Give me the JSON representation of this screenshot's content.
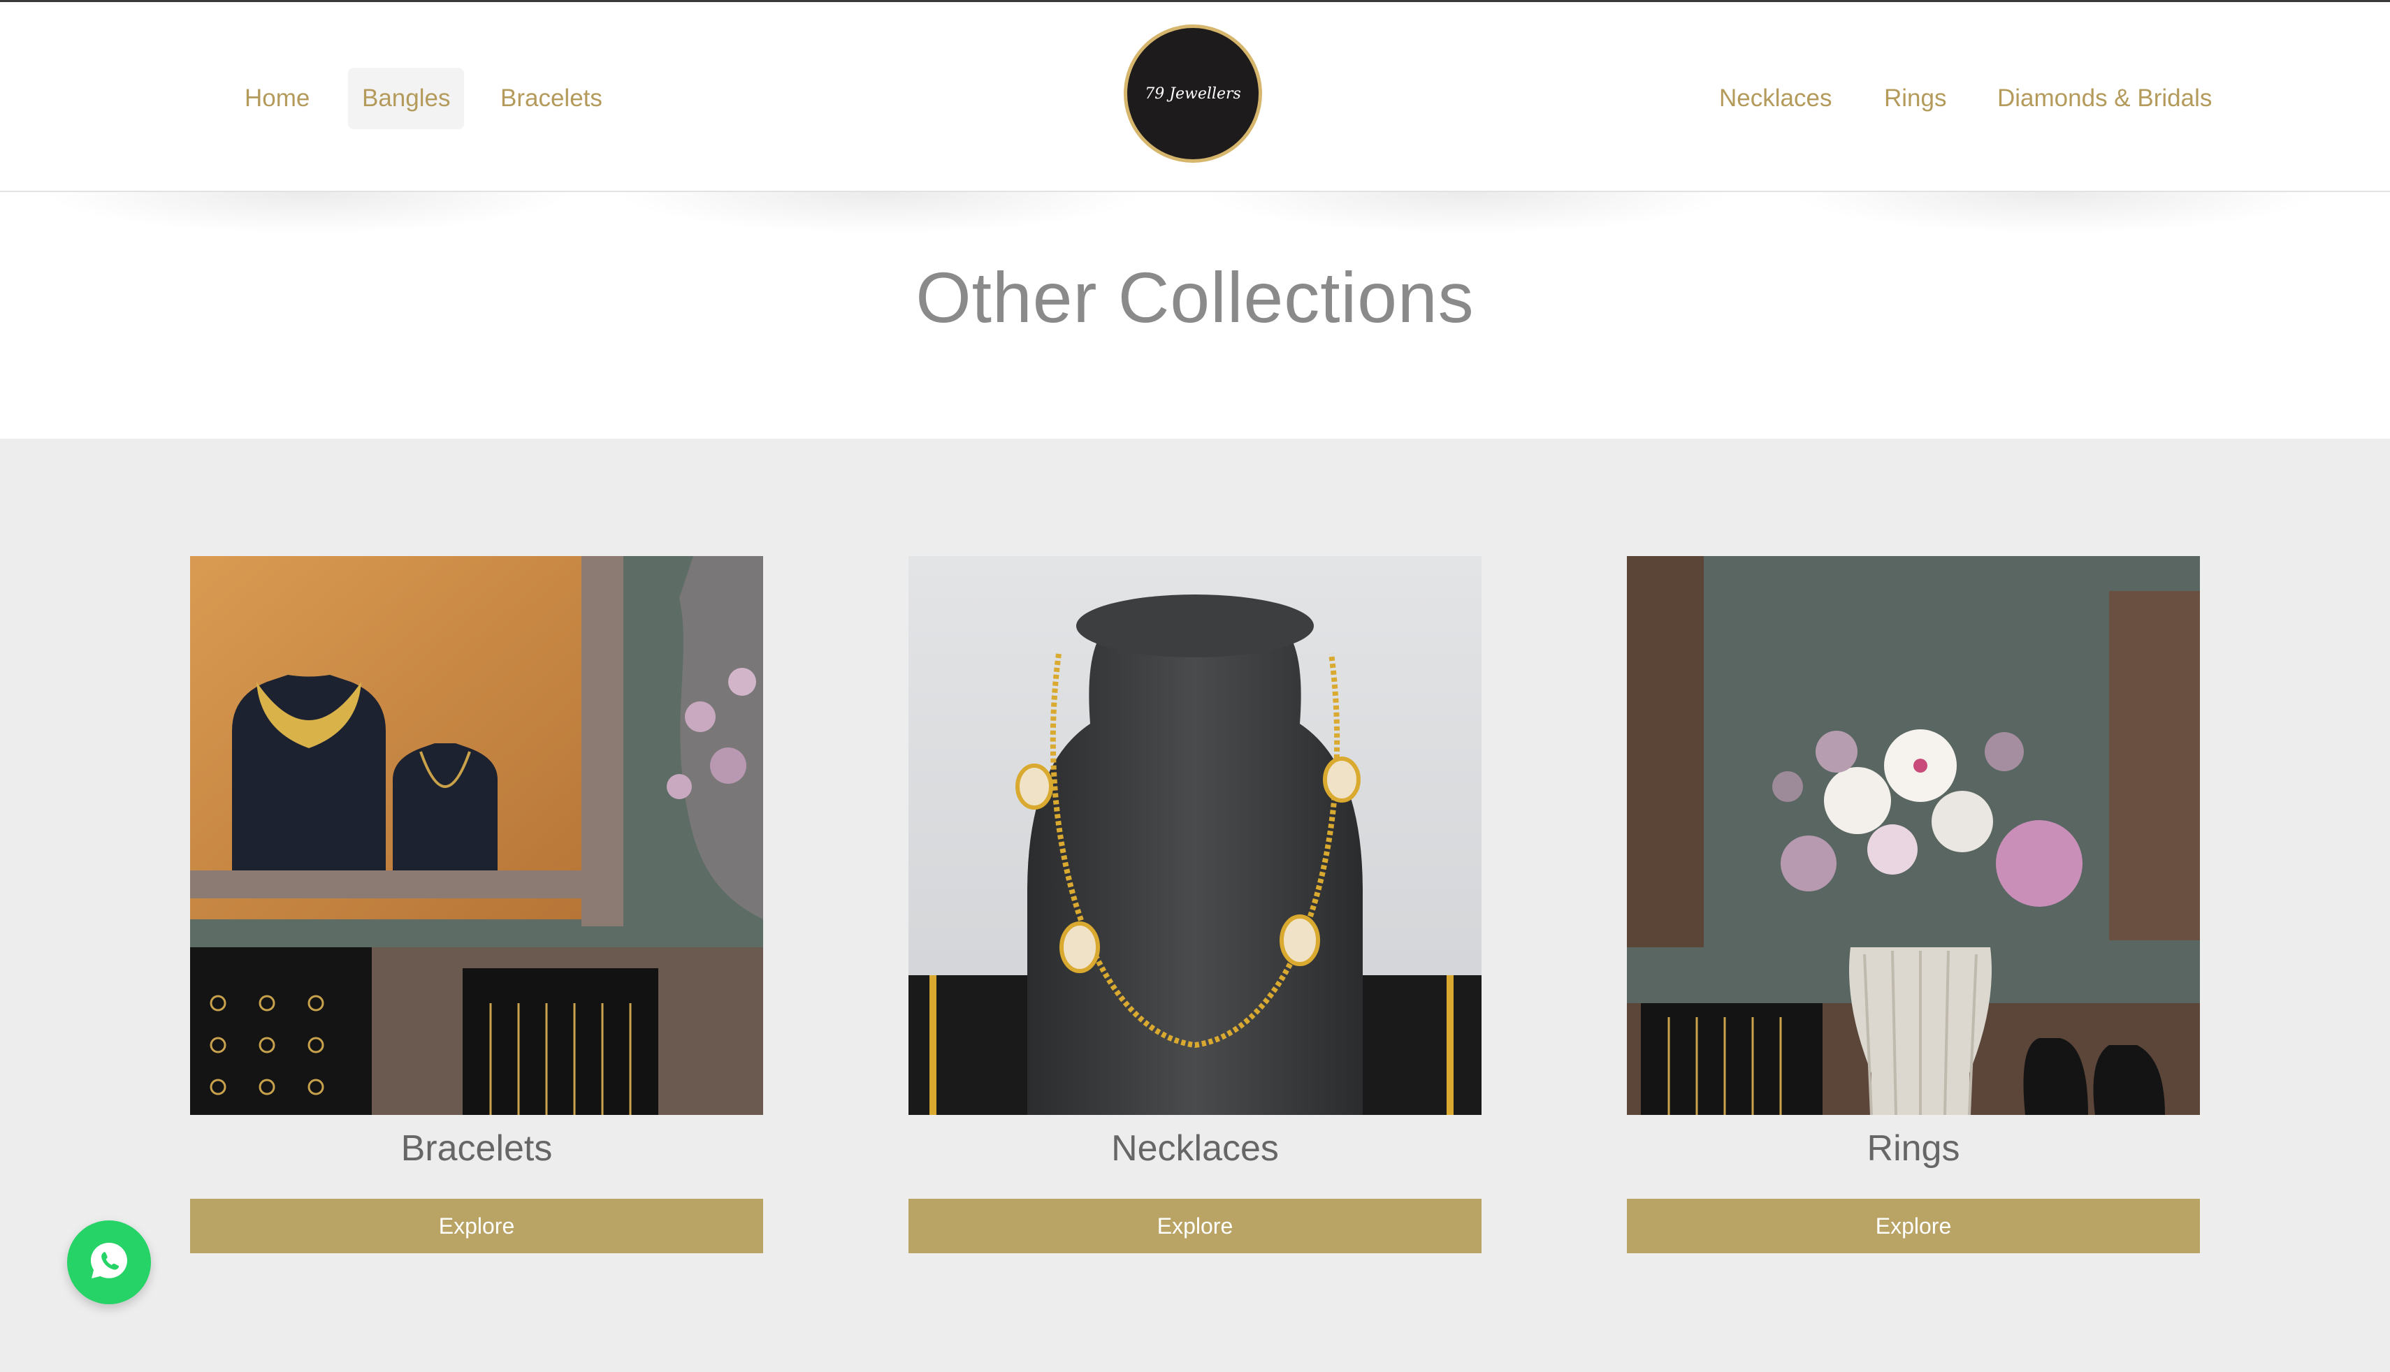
{
  "nav": {
    "left": [
      {
        "label": "Home"
      },
      {
        "label": "Bangles"
      },
      {
        "label": "Bracelets"
      }
    ],
    "right": [
      {
        "label": "Necklaces"
      },
      {
        "label": "Rings"
      },
      {
        "label": "Diamonds & Bridals"
      }
    ],
    "active": "Bangles",
    "link_color": "#b49b5c"
  },
  "logo": {
    "text": "79 Jewellers"
  },
  "section": {
    "title": "Other Collections"
  },
  "cards": [
    {
      "title": "Bracelets",
      "button": "Explore"
    },
    {
      "title": "Necklaces",
      "button": "Explore"
    },
    {
      "title": "Rings",
      "button": "Explore"
    }
  ],
  "colors": {
    "accent": "#b9a466",
    "section_bg": "#ededed",
    "whatsapp": "#25d366"
  },
  "icons": {
    "chat": "whatsapp-icon"
  }
}
